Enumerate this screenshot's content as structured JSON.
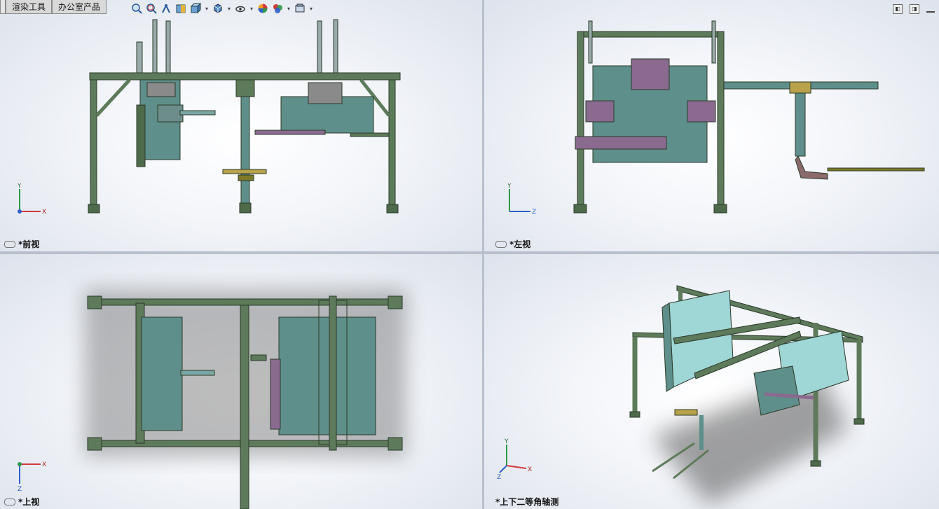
{
  "tabs": [
    "",
    "渲染工具",
    "办公室产品"
  ],
  "toolbar_icons": [
    "zoom-to-fit-icon",
    "zoom-area-icon",
    "previous-view-icon",
    "section-view-icon",
    "view-orientation-icon",
    "display-style-icon",
    "hide-show-icon",
    "edit-appearance-icon",
    "apply-scene-icon",
    "view-settings-icon"
  ],
  "viewports": {
    "front": {
      "label": "*前视",
      "axes": [
        "Y",
        "X"
      ]
    },
    "left": {
      "label": "*左视",
      "axes": [
        "Y",
        "Z"
      ]
    },
    "top": {
      "label": "*上视",
      "axes": [
        "X",
        "Z"
      ]
    },
    "iso": {
      "label": "*上下二等角轴测",
      "axes": [
        "Y",
        "X",
        "Z"
      ]
    }
  },
  "colors": {
    "frame": "#5d7a5a",
    "panel": "#5f8f8a",
    "purple": "#8a6a8f",
    "accent": "#3f5a3c"
  }
}
